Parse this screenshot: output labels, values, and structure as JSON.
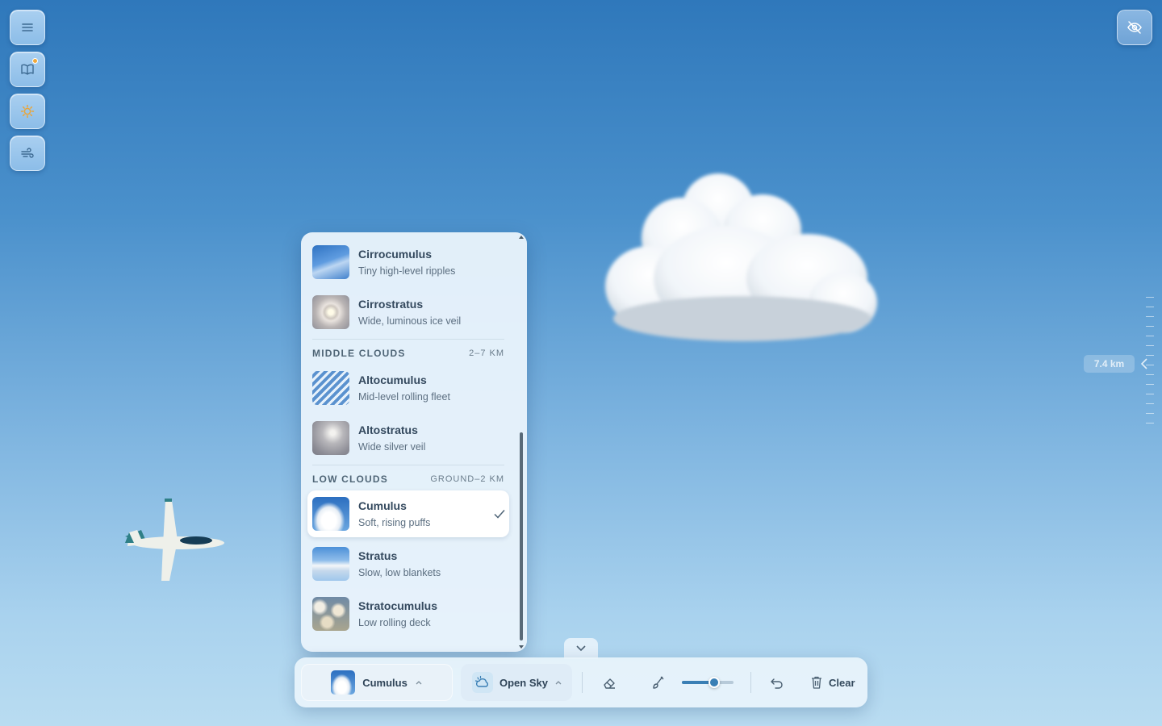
{
  "sidebar": {
    "buttons": [
      {
        "icon": "menu-icon"
      },
      {
        "icon": "book-icon",
        "has_badge": true
      },
      {
        "icon": "sun-icon"
      },
      {
        "icon": "wind-icon"
      }
    ]
  },
  "top_right": {
    "icon": "eye-off-icon"
  },
  "altitude": {
    "label": "7.4 km"
  },
  "panel": {
    "top_items": [
      {
        "name": "Cirrocumulus",
        "desc": "Tiny high-level ripples"
      },
      {
        "name": "Cirrostratus",
        "desc": "Wide, luminous ice veil"
      }
    ],
    "groups": [
      {
        "title": "MIDDLE CLOUDS",
        "range": "2–7 KM",
        "items": [
          {
            "name": "Altocumulus",
            "desc": "Mid-level rolling fleet"
          },
          {
            "name": "Altostratus",
            "desc": "Wide silver veil"
          }
        ]
      },
      {
        "title": "LOW CLOUDS",
        "range": "GROUND–2 KM",
        "items": [
          {
            "name": "Cumulus",
            "desc": "Soft, rising puffs",
            "selected": true
          },
          {
            "name": "Stratus",
            "desc": "Slow, low blankets"
          },
          {
            "name": "Stratocumulus",
            "desc": "Low rolling deck"
          }
        ]
      }
    ]
  },
  "toolbar": {
    "cloud_label": "Cumulus",
    "scene_label": "Open Sky",
    "clear_label": "Clear",
    "brush_size": 0.65
  },
  "colors": {
    "accent": "#3a7fb5",
    "badge": "#f0a93a"
  }
}
